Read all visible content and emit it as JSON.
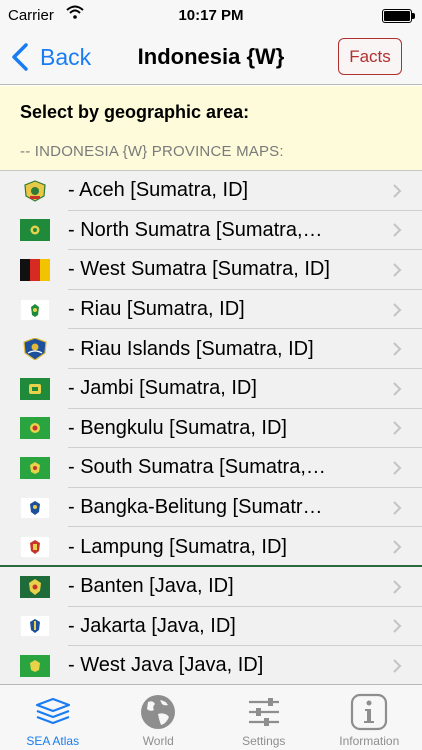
{
  "status_bar": {
    "carrier": "Carrier",
    "time": "10:17 PM",
    "battery_level": 1.0
  },
  "nav": {
    "back_label": "Back",
    "title": "Indonesia {W}",
    "facts_label": "Facts"
  },
  "header": {
    "prompt": "Select by geographic area:",
    "section_title": "-- INDONESIA {W} PROVINCE MAPS:"
  },
  "provinces": [
    {
      "label": "- Aceh  [Sumatra, ID]",
      "flag_icon": "aceh-emblem-icon"
    },
    {
      "label": "- North Sumatra  [Sumatra,…",
      "flag_icon": "north-sumatra-flag-icon"
    },
    {
      "label": "- West Sumatra  [Sumatra, ID]",
      "flag_icon": "west-sumatra-flag-icon"
    },
    {
      "label": "- Riau  [Sumatra, ID]",
      "flag_icon": "riau-flag-icon"
    },
    {
      "label": "- Riau Islands  [Sumatra, ID]",
      "flag_icon": "riau-islands-emblem-icon"
    },
    {
      "label": "- Jambi  [Sumatra, ID]",
      "flag_icon": "jambi-flag-icon"
    },
    {
      "label": "- Bengkulu  [Sumatra, ID]",
      "flag_icon": "bengkulu-flag-icon"
    },
    {
      "label": "- South Sumatra  [Sumatra,…",
      "flag_icon": "south-sumatra-flag-icon"
    },
    {
      "label": "- Bangka-Belitung  [Sumatr…",
      "flag_icon": "bangka-belitung-flag-icon"
    },
    {
      "label": "- Lampung  [Sumatra, ID]",
      "flag_icon": "lampung-flag-icon"
    },
    {
      "label": "- Banten  [Java, ID]",
      "flag_icon": "banten-flag-icon"
    },
    {
      "label": "- Jakarta  [Java, ID]",
      "flag_icon": "jakarta-flag-icon"
    },
    {
      "label": "- West Java  [Java, ID]",
      "flag_icon": "west-java-flag-icon"
    }
  ],
  "tabs": [
    {
      "label": "SEA Atlas",
      "icon": "map-stack-icon",
      "active": true
    },
    {
      "label": "World",
      "icon": "globe-icon",
      "active": false
    },
    {
      "label": "Settings",
      "icon": "sliders-icon",
      "active": false
    },
    {
      "label": "Information",
      "icon": "info-icon",
      "active": false
    }
  ],
  "colors": {
    "accent": "#1a7cf2",
    "facts": "#b03030",
    "header_bg": "#fdfbd9",
    "divider_green": "#2d6b3c"
  }
}
